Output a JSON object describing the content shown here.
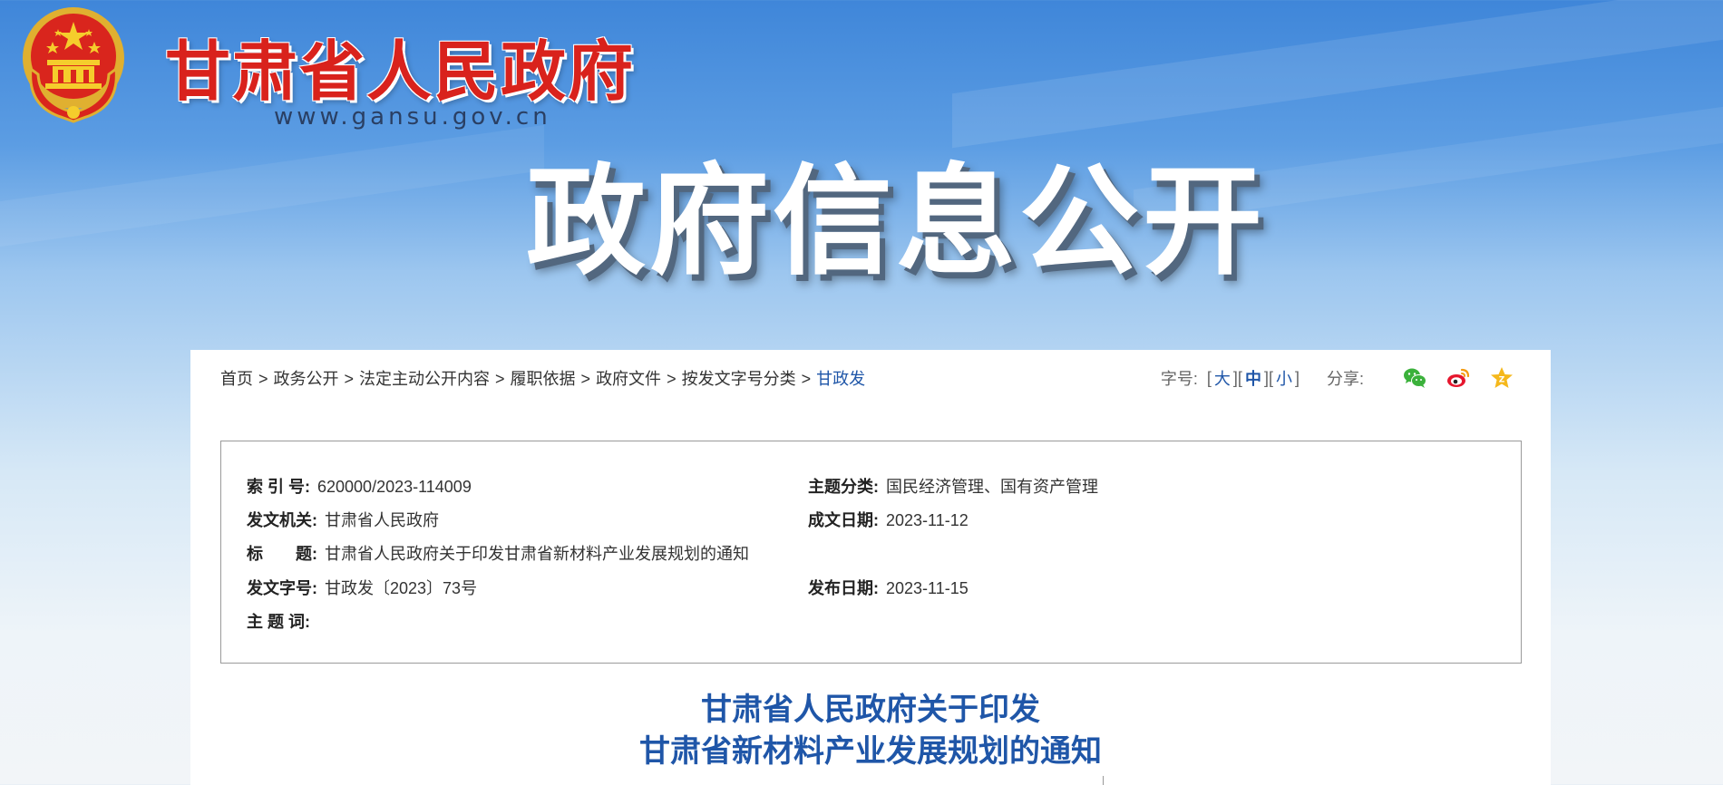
{
  "header": {
    "site_title": "甘肃省人民政府",
    "site_url": "www.gansu.gov.cn",
    "hero_title": "政府信息公开"
  },
  "breadcrumb": {
    "items": [
      "首页",
      "政务公开",
      "法定主动公开内容",
      "履职依据",
      "政府文件",
      "按发文字号分类",
      "甘政发"
    ],
    "separator": ">"
  },
  "font_size": {
    "label": "字号:",
    "options": [
      "大",
      "中",
      "小"
    ],
    "selected": "中"
  },
  "share": {
    "label": "分享:",
    "icons": [
      "wechat-icon",
      "weibo-icon",
      "favorite-star-icon"
    ]
  },
  "meta": {
    "index_no_label": "索 引 号:",
    "index_no": "620000/2023-114009",
    "topic_label": "主题分类:",
    "topic": "国民经济管理、国有资产管理",
    "issuer_label": "发文机关:",
    "issuer": "甘肃省人民政府",
    "created_label": "成文日期:",
    "created": "2023-11-12",
    "title_label": "标　　题:",
    "title": "甘肃省人民政府关于印发甘肃省新材料产业发展规划的通知",
    "doc_no_label": "发文字号:",
    "doc_no": "甘政发〔2023〕73号",
    "published_label": "发布日期:",
    "published": "2023-11-15",
    "keywords_label": "主 题 词:",
    "keywords": ""
  },
  "document": {
    "title_line1": "甘肃省人民政府关于印发",
    "title_line2": "甘肃省新材料产业发展规划的通知"
  },
  "colors": {
    "brand_red": "#d9221c",
    "link_blue": "#1f56a8",
    "sky_top": "#3f86d9"
  }
}
